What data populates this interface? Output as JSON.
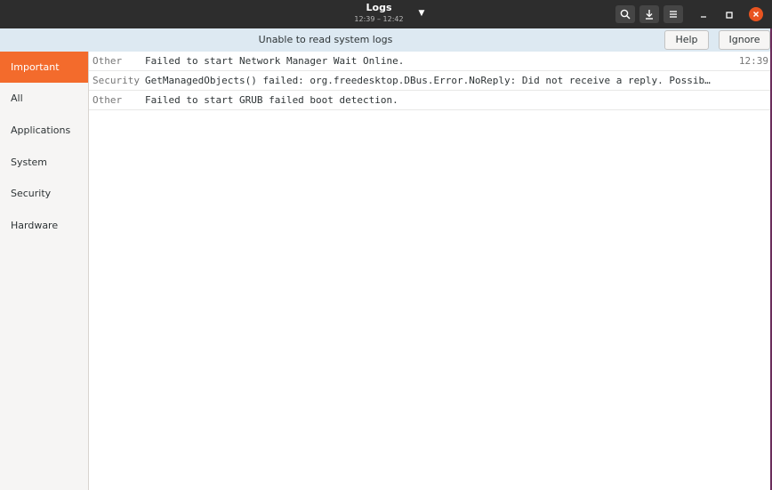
{
  "header": {
    "title": "Logs",
    "subtitle": "12:39 – 12:42",
    "dropdown_icon": "pan-down-icon",
    "buttons": [
      "search-icon",
      "export-icon",
      "hamburger-menu-icon"
    ],
    "window_controls": [
      "minimize-icon",
      "maximize-icon",
      "close-icon"
    ]
  },
  "infobar": {
    "message": "Unable to read system logs",
    "help_label": "Help",
    "ignore_label": "Ignore"
  },
  "sidebar": {
    "items": [
      {
        "label": "Important",
        "active": true
      },
      {
        "label": "All"
      },
      {
        "label": "Applications"
      },
      {
        "label": "System"
      },
      {
        "label": "Security"
      },
      {
        "label": "Hardware"
      }
    ]
  },
  "logs": [
    {
      "category": "Other",
      "message": "Failed to start Network Manager Wait Online.",
      "time": "12:39"
    },
    {
      "category": "Security",
      "message": "GetManagedObjects() failed: org.freedesktop.DBus.Error.NoReply: Did not receive a reply. Possib…",
      "time": ""
    },
    {
      "category": "Other",
      "message": "Failed to start GRUB failed boot detection.",
      "time": ""
    }
  ],
  "colors": {
    "accent": "#f36b2c",
    "close_button": "#e95420",
    "headerbar": "#2d2d2d",
    "infobar": "#dde9f2"
  }
}
